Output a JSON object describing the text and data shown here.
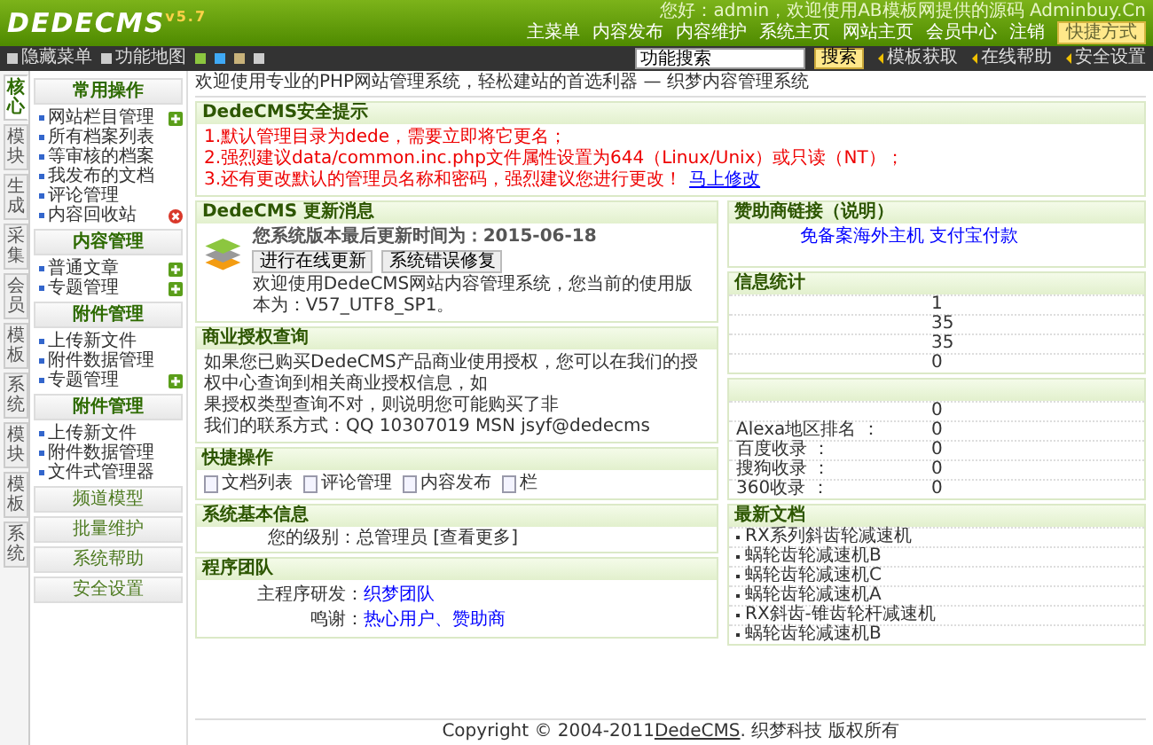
{
  "header": {
    "logo": "DEDECMS",
    "version": "v5.7",
    "greeting": "您好：admin，欢迎使用AB模板网提供的源码 Adminbuy.Cn",
    "links": [
      "主菜单",
      "内容发布",
      "内容维护",
      "系统主页",
      "网站主页",
      "会员中心",
      "注销"
    ],
    "shortcut": "快捷方式"
  },
  "toolbar": {
    "items": [
      "隐藏菜单",
      "功能地图"
    ],
    "swatches": [
      {
        "color": "#8cc63f"
      },
      {
        "color": "#3fa9f5"
      },
      {
        "color": "#c8b27a"
      },
      {
        "color": "#cccccc"
      }
    ],
    "search": {
      "value": "功能搜索"
    },
    "search_button": "搜索",
    "links": [
      "模板获取",
      "在线帮助",
      "安全设置"
    ]
  },
  "sidebar": {
    "tabs": [
      {
        "label": "核心",
        "selected": true
      },
      {
        "label": "模块",
        "selected": false
      },
      {
        "label": "生成",
        "selected": false
      },
      {
        "label": "采集",
        "selected": false
      },
      {
        "label": "会员",
        "selected": false
      },
      {
        "label": "模板",
        "selected": false
      },
      {
        "label": "系统",
        "selected": false
      },
      {
        "label": "模块",
        "selected": false
      },
      {
        "label": "模板",
        "selected": false
      },
      {
        "label": "系统",
        "selected": false
      }
    ],
    "groups": [
      {
        "title": "常用操作",
        "expanded": true,
        "items": [
          {
            "label": "网站栏目管理",
            "kind": "add"
          },
          {
            "label": "所有档案列表",
            "kind": "plain"
          },
          {
            "label": "等审核的档案",
            "kind": "plain"
          },
          {
            "label": "我发布的文档",
            "kind": "plain"
          },
          {
            "label": "评论管理",
            "kind": "plain"
          },
          {
            "label": "内容回收站",
            "kind": "remove"
          }
        ]
      },
      {
        "title": "内容管理",
        "expanded": true,
        "items": [
          {
            "label": "普通文章",
            "kind": "add"
          },
          {
            "label": "专题管理",
            "kind": "add"
          }
        ]
      },
      {
        "title": "附件管理",
        "expanded": true,
        "items": [
          {
            "label": "上传新文件",
            "kind": "plain"
          },
          {
            "label": "附件数据管理",
            "kind": "plain"
          },
          {
            "label": "专题管理",
            "kind": "add"
          }
        ]
      },
      {
        "title": "附件管理",
        "expanded": true,
        "items": [
          {
            "label": "上传新文件",
            "kind": "plain"
          },
          {
            "label": "附件数据管理",
            "kind": "plain"
          },
          {
            "label": "文件式管理器",
            "kind": "plain"
          }
        ]
      },
      {
        "title": "频道模型",
        "expanded": false
      },
      {
        "title": "批量维护",
        "expanded": false
      },
      {
        "title": "系统帮助",
        "expanded": false
      },
      {
        "title": "安全设置",
        "expanded": false
      }
    ]
  },
  "welcome": "欢迎使用专业的PHP网站管理系统，轻松建站的首选利器 — 织梦内容管理系统",
  "security": {
    "title": "DedeCMS安全提示",
    "lines": [
      "1.默认管理目录为dede，需要立即将它更名；",
      "2.强烈建议data/common.inc.php文件属性设置为644（Linux/Unix）或只读（NT）；",
      "3.还有更改默认的管理员名称和密码，强烈建议您进行更改！"
    ],
    "link": "马上修改"
  },
  "update": {
    "title": "DedeCMS 更新消息",
    "headline": "您系统版本最后更新时间为：2015-06-18",
    "buttons": [
      "进行在线更新",
      "系统错误修复"
    ],
    "text": "欢迎使用DedeCMS网站内容管理系统，您当前的使用版本为：V57_UTF8_SP1。"
  },
  "license": {
    "title": "商业授权查询",
    "lines": [
      "如果您已购买DedeCMS产品商业使用授权，您可以在我们的授权中心查询到相关商业授权信息，如",
      "果授权类型查询不对，则说明您可能购买了非",
      "我们的联系方式：QQ 10307019 MSN jsyf@dedecms"
    ]
  },
  "quick": {
    "title": "快捷操作",
    "items": [
      {
        "label": "文档列表"
      },
      {
        "label": "评论管理"
      },
      {
        "label": "内容发布"
      },
      {
        "label": "栏"
      }
    ]
  },
  "system": {
    "title": "系统基本信息",
    "label": "您的级别：",
    "value": "总管理员 [查看更多]"
  },
  "team": {
    "title": "程序团队",
    "rows": [
      {
        "label": "主程序研发：",
        "value": "织梦团队"
      },
      {
        "label": "鸣谢：",
        "value": "热心用户、赞助商"
      }
    ]
  },
  "sponsor": {
    "title": "赞助商链接（说明）",
    "link": "免备案海外主机 支付宝付款"
  },
  "stats": {
    "title": "信息统计",
    "rows": [
      {
        "value": "1"
      },
      {
        "value": "35"
      },
      {
        "value": "35"
      },
      {
        "value": "0"
      }
    ]
  },
  "ranks": {
    "rows": [
      {
        "value": "0"
      },
      {
        "label": "Alexa地区排名 ：",
        "value": "0"
      },
      {
        "label": "百度收录 ：",
        "value": "0"
      },
      {
        "label": "搜狗收录 ：",
        "value": "0"
      },
      {
        "label": "360收录 ：",
        "value": "0"
      }
    ]
  },
  "latest": {
    "title": "最新文档",
    "items": [
      "RX系列斜齿轮减速机",
      "蜗轮齿轮减速机B",
      "蜗轮齿轮减速机C",
      "蜗轮齿轮减速机A",
      "RX斜齿-锥齿轮杆减速机",
      "蜗轮齿轮减速机B"
    ]
  },
  "footer": {
    "prefix": "Copyright © 2004-2011",
    "link": "DedeCMS",
    "suffix": ". 织梦科技 版权所有"
  }
}
